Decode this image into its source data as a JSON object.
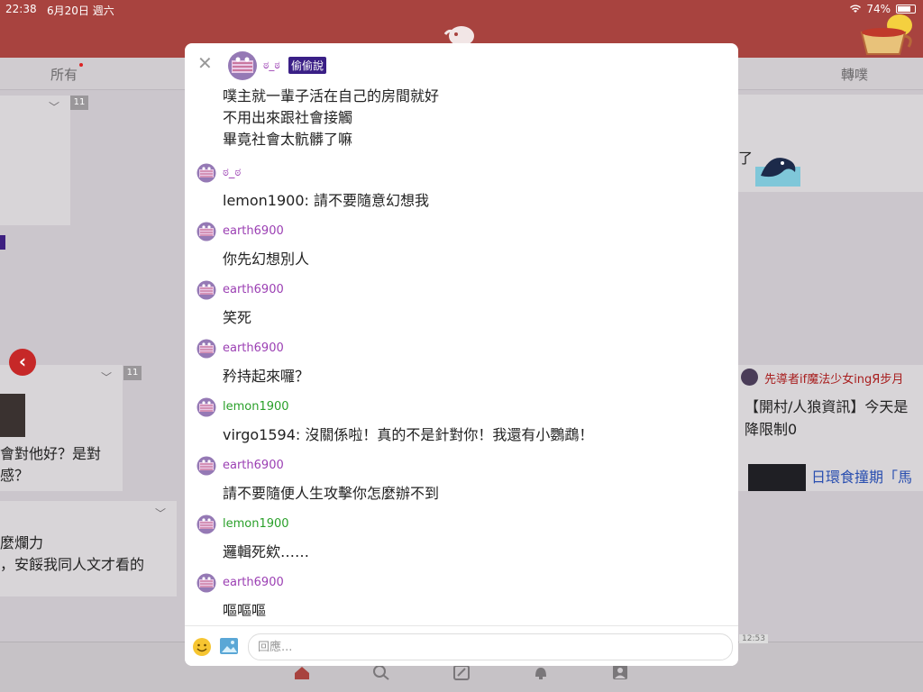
{
  "status": {
    "time": "22:38",
    "date": "6月20日 週六",
    "battery": "74%"
  },
  "tabs": {
    "all": "所有",
    "replurk": "轉噗"
  },
  "background": {
    "badge_count": "11",
    "left_lines": [
      "會對他好？是對",
      "感？"
    ],
    "left_lines2": [
      "麼爛力",
      "，安餒我同人文才看的"
    ],
    "right_fragment": "了",
    "poster": "先導者if魔法少女ingЯ步月",
    "right_lines": [
      "【開村/人狼資訊】今天是",
      "降限制0"
    ],
    "right_link": "日環食撞期「馬",
    "timestamp": "12:53"
  },
  "modal": {
    "op": {
      "name": "ಠ_ಠ",
      "whisper_label": "偷偷說",
      "lines": [
        "噗主就一輩子活在自己的房間就好",
        "不用出來跟社會接觸",
        "畢竟社會太骯髒了嘛"
      ]
    },
    "responses": [
      {
        "name": "ಠ_ಠ",
        "color": "purple",
        "text": "lemon1900: 請不要隨意幻想我"
      },
      {
        "name": "earth6900",
        "color": "purple",
        "text": "你先幻想別人"
      },
      {
        "name": "earth6900",
        "color": "purple",
        "text": "笑死"
      },
      {
        "name": "earth6900",
        "color": "purple",
        "text": "矜持起來囉？"
      },
      {
        "name": "lemon1900",
        "color": "green",
        "text": "virgo1594: 沒關係啦！真的不是針對你！我還有小鸚鵡！"
      },
      {
        "name": "earth6900",
        "color": "purple",
        "text": "請不要隨便人生攻擊你怎麼辦不到"
      },
      {
        "name": "lemon1900",
        "color": "green",
        "text": "邏輯死欸……"
      },
      {
        "name": "earth6900",
        "color": "purple",
        "text": "嘔嘔嘔"
      }
    ],
    "composer": {
      "placeholder": "回應..."
    }
  },
  "colors": {
    "header": "#a8433f",
    "name_purple": "#9b3fb3",
    "name_green": "#2aa02a",
    "whisper_bg": "#3a1f86"
  }
}
